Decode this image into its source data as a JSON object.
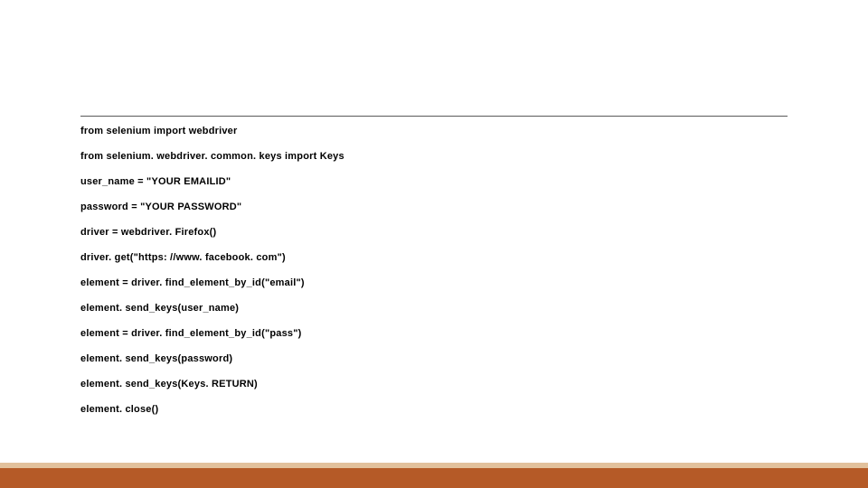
{
  "code": {
    "lines": [
      "from selenium import webdriver",
      "from selenium. webdriver. common. keys import Keys",
      "user_name = \"YOUR EMAILID\"",
      "password = \"YOUR PASSWORD\"",
      "driver = webdriver. Firefox()",
      "driver. get(\"https: //www. facebook. com\")",
      "element = driver. find_element_by_id(\"email\")",
      "element. send_keys(user_name)",
      "element = driver. find_element_by_id(\"pass\")",
      "element. send_keys(password)",
      "element. send_keys(Keys. RETURN)",
      "element. close()"
    ]
  },
  "colors": {
    "footer_dark": "#b55a27",
    "footer_light": "#e2c19c",
    "divider": "#595959"
  }
}
